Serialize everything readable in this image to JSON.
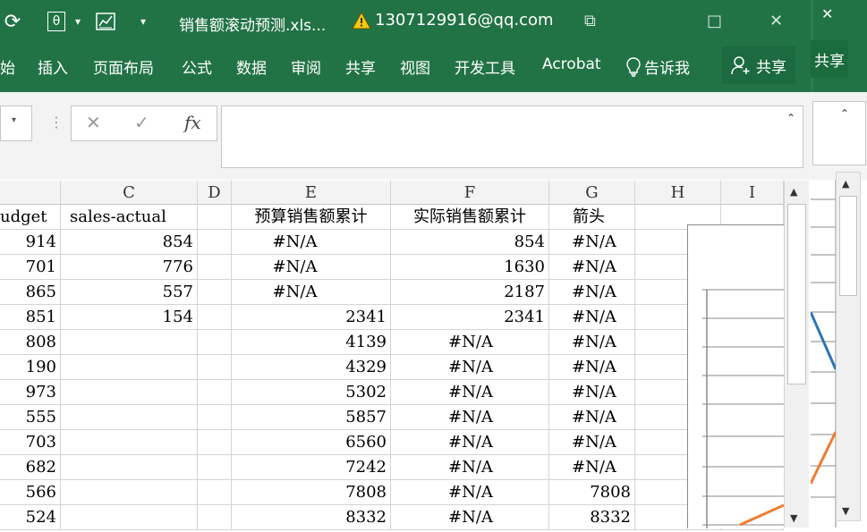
{
  "titlebar": {
    "doc_title": "销售额滚动预测.xls...",
    "account": "1307129916@qq.com",
    "qat": [
      "⟳",
      "θ",
      "▾",
      "▤",
      "▾"
    ],
    "window_buttons": [
      "⧉",
      "□",
      "✕"
    ]
  },
  "ribbon": {
    "tabs": [
      "始",
      "插入",
      "页面布局",
      "公式",
      "数据",
      "审阅",
      "共享",
      "视图",
      "开发工具",
      "Acrobat"
    ],
    "tell_me": "告诉我",
    "share": "共享",
    "share_partial": "共享"
  },
  "formula_bar": {
    "cancel": "✕",
    "enter": "✓",
    "fx": "fx",
    "value": ""
  },
  "columns": [
    {
      "letter": "",
      "header": "udget"
    },
    {
      "letter": "C",
      "header": "sales-actual"
    },
    {
      "letter": "D",
      "header": ""
    },
    {
      "letter": "E",
      "header": "预算销售额累计"
    },
    {
      "letter": "F",
      "header": "实际销售额累计"
    },
    {
      "letter": "G",
      "header": "箭头"
    },
    {
      "letter": "H",
      "header": ""
    },
    {
      "letter": "I",
      "header": ""
    }
  ],
  "rows": [
    [
      "914",
      "854",
      "",
      "#N/A",
      "854",
      "#N/A"
    ],
    [
      "701",
      "776",
      "",
      "#N/A",
      "1630",
      "#N/A"
    ],
    [
      "865",
      "557",
      "",
      "#N/A",
      "2187",
      "#N/A"
    ],
    [
      "851",
      "154",
      "",
      "2341",
      "2341",
      "#N/A"
    ],
    [
      "808",
      "",
      "",
      "4139",
      "#N/A",
      "#N/A"
    ],
    [
      "190",
      "",
      "",
      "4329",
      "#N/A",
      "#N/A"
    ],
    [
      "973",
      "",
      "",
      "5302",
      "#N/A",
      "#N/A"
    ],
    [
      "555",
      "",
      "",
      "5857",
      "#N/A",
      "#N/A"
    ],
    [
      "703",
      "",
      "",
      "6560",
      "#N/A",
      "#N/A"
    ],
    [
      "682",
      "",
      "",
      "7242",
      "#N/A",
      "#N/A"
    ],
    [
      "566",
      "",
      "",
      "7808",
      "#N/A",
      "7808"
    ],
    [
      "524",
      "",
      "",
      "8332",
      "#N/A",
      "8332"
    ]
  ],
  "colors": {
    "ribbon_green": "#217346",
    "series_blue": "#2e75b6",
    "series_orange": "#ed7d31"
  }
}
